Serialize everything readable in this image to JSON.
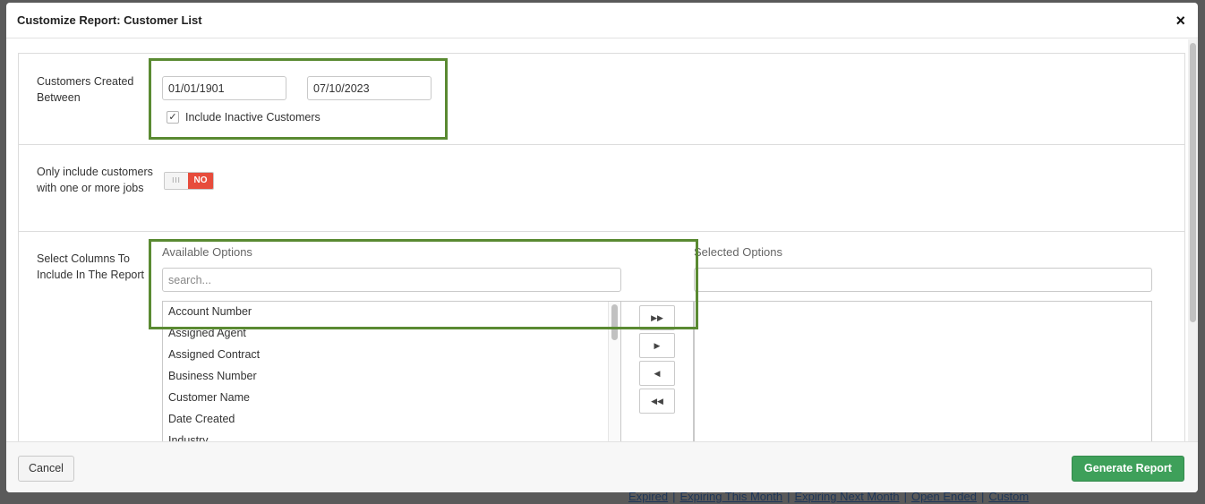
{
  "dialog": {
    "title": "Customize Report: Customer List",
    "close_glyph": "×"
  },
  "date_range": {
    "label": "Customers Created Between",
    "start_date": "01/01/1901",
    "end_date": "07/10/2023",
    "include_inactive_label": "Include Inactive Customers",
    "include_inactive_checked": true,
    "check_glyph": "✓"
  },
  "jobs_filter": {
    "label": "Only include customers with one or more jobs",
    "toggle_handle": "III",
    "toggle_state": "NO",
    "toggle_color": "#e74c3c"
  },
  "columns": {
    "label": "Select Columns To Include In The Report",
    "available_title": "Available Options",
    "available_search_placeholder": "search...",
    "available_options": [
      "Account Number",
      "Assigned Agent",
      "Assigned Contract",
      "Business Number",
      "Customer Name",
      "Date Created",
      "Industry"
    ],
    "selected_title": "Selected Options",
    "selected_options": [],
    "move_buttons": {
      "add_all": "▶▶",
      "add_one": "▶",
      "remove_one": "◀",
      "remove_all": "◀◀"
    }
  },
  "footer": {
    "cancel_label": "Cancel",
    "generate_label": "Generate Report",
    "generate_color": "#3ea05a"
  },
  "highlight_color": "#5a8a32",
  "background_links": [
    "Expired",
    "Expiring This Month",
    "Expiring Next Month",
    "Open Ended",
    "Custom"
  ]
}
